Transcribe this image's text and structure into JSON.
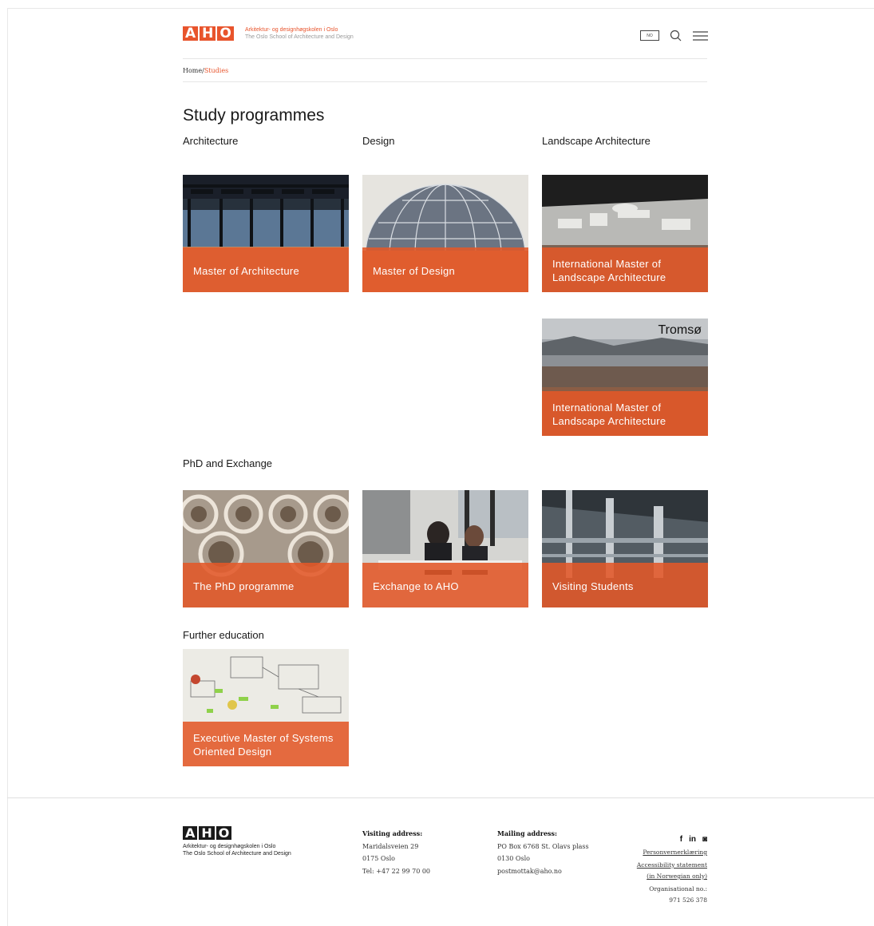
{
  "header": {
    "logo_letters": [
      "A",
      "H",
      "O"
    ],
    "logo_line1": "Arkitektur- og designhøgskolen i Oslo",
    "logo_line2": "The Oslo School of Architecture and Design",
    "lang_label": "NO",
    "search_icon": "search-icon",
    "menu_icon": "menu-icon"
  },
  "breadcrumb": {
    "home": "Home",
    "sep": "/",
    "current": "Studies"
  },
  "page_title": "Study programmes",
  "sections": {
    "architecture": "Architecture",
    "design": "Design",
    "landscape": "Landscape Architecture",
    "phd": "PhD and Exchange",
    "further": "Further education"
  },
  "cards": {
    "master_arch": "Master of Architecture",
    "master_design": "Master of Design",
    "intl_landscape_1": "International Master of Landscape Architecture",
    "tromso_tag": "Tromsø",
    "intl_landscape_2": "International Master of Landscape Architecture",
    "phd_programme": "The PhD programme",
    "exchange": "Exchange to AHO",
    "visiting": "Visiting Students",
    "executive": "Executive Master of Systems Oriented Design"
  },
  "footer": {
    "logo_letters": [
      "A",
      "H",
      "O"
    ],
    "name_line1": "Arkitektur- og designhøgskolen i Oslo",
    "name_line2": "The Oslo School of Architecture and Design",
    "visiting_heading": "Visiting address:",
    "visiting_street": "Maridalsveien 29",
    "visiting_city": "0175 Oslo",
    "visiting_tel": "Tel: +47 22 99 70 00",
    "mailing_heading": "Mailing address:",
    "mailing_box": "PO Box 6768 St. Olavs plass",
    "mailing_city": "0130 Oslo",
    "mailing_email": "postmottak@aho.no",
    "social": [
      "f",
      "in",
      "◙"
    ],
    "privacy_link": "Personvernerklæring",
    "accessibility_link": "Accessibility statement",
    "accessibility_note": "(in Norwegian only)",
    "org_label": "Organisational no.:",
    "org_number": "971 526 378"
  },
  "colors": {
    "accent": "#e8542c",
    "overlay": "#e25828"
  }
}
